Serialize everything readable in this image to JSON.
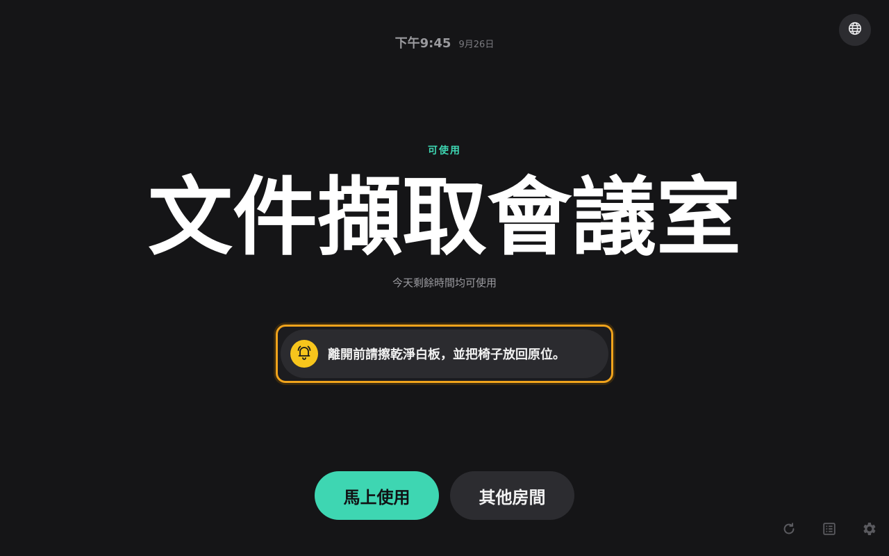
{
  "header": {
    "time": "下午9:45",
    "date": "9月26日",
    "language_icon": "globe-icon"
  },
  "room": {
    "status": "可使用",
    "status_color": "#3ed6b2",
    "name": "文件擷取會議室",
    "availability": "今天剩餘時間均可使用"
  },
  "notice": {
    "icon": "bell-icon",
    "icon_color": "#f7c51c",
    "text": "離開前請擦乾淨白板，並把椅子放回原位。",
    "highlight_color": "#f0a31c"
  },
  "actions": {
    "use_now": "馬上使用",
    "other_rooms": "其他房間",
    "accent": "#3ed6b2"
  },
  "footer_icons": [
    "refresh-icon",
    "list-icon",
    "gear-icon"
  ]
}
